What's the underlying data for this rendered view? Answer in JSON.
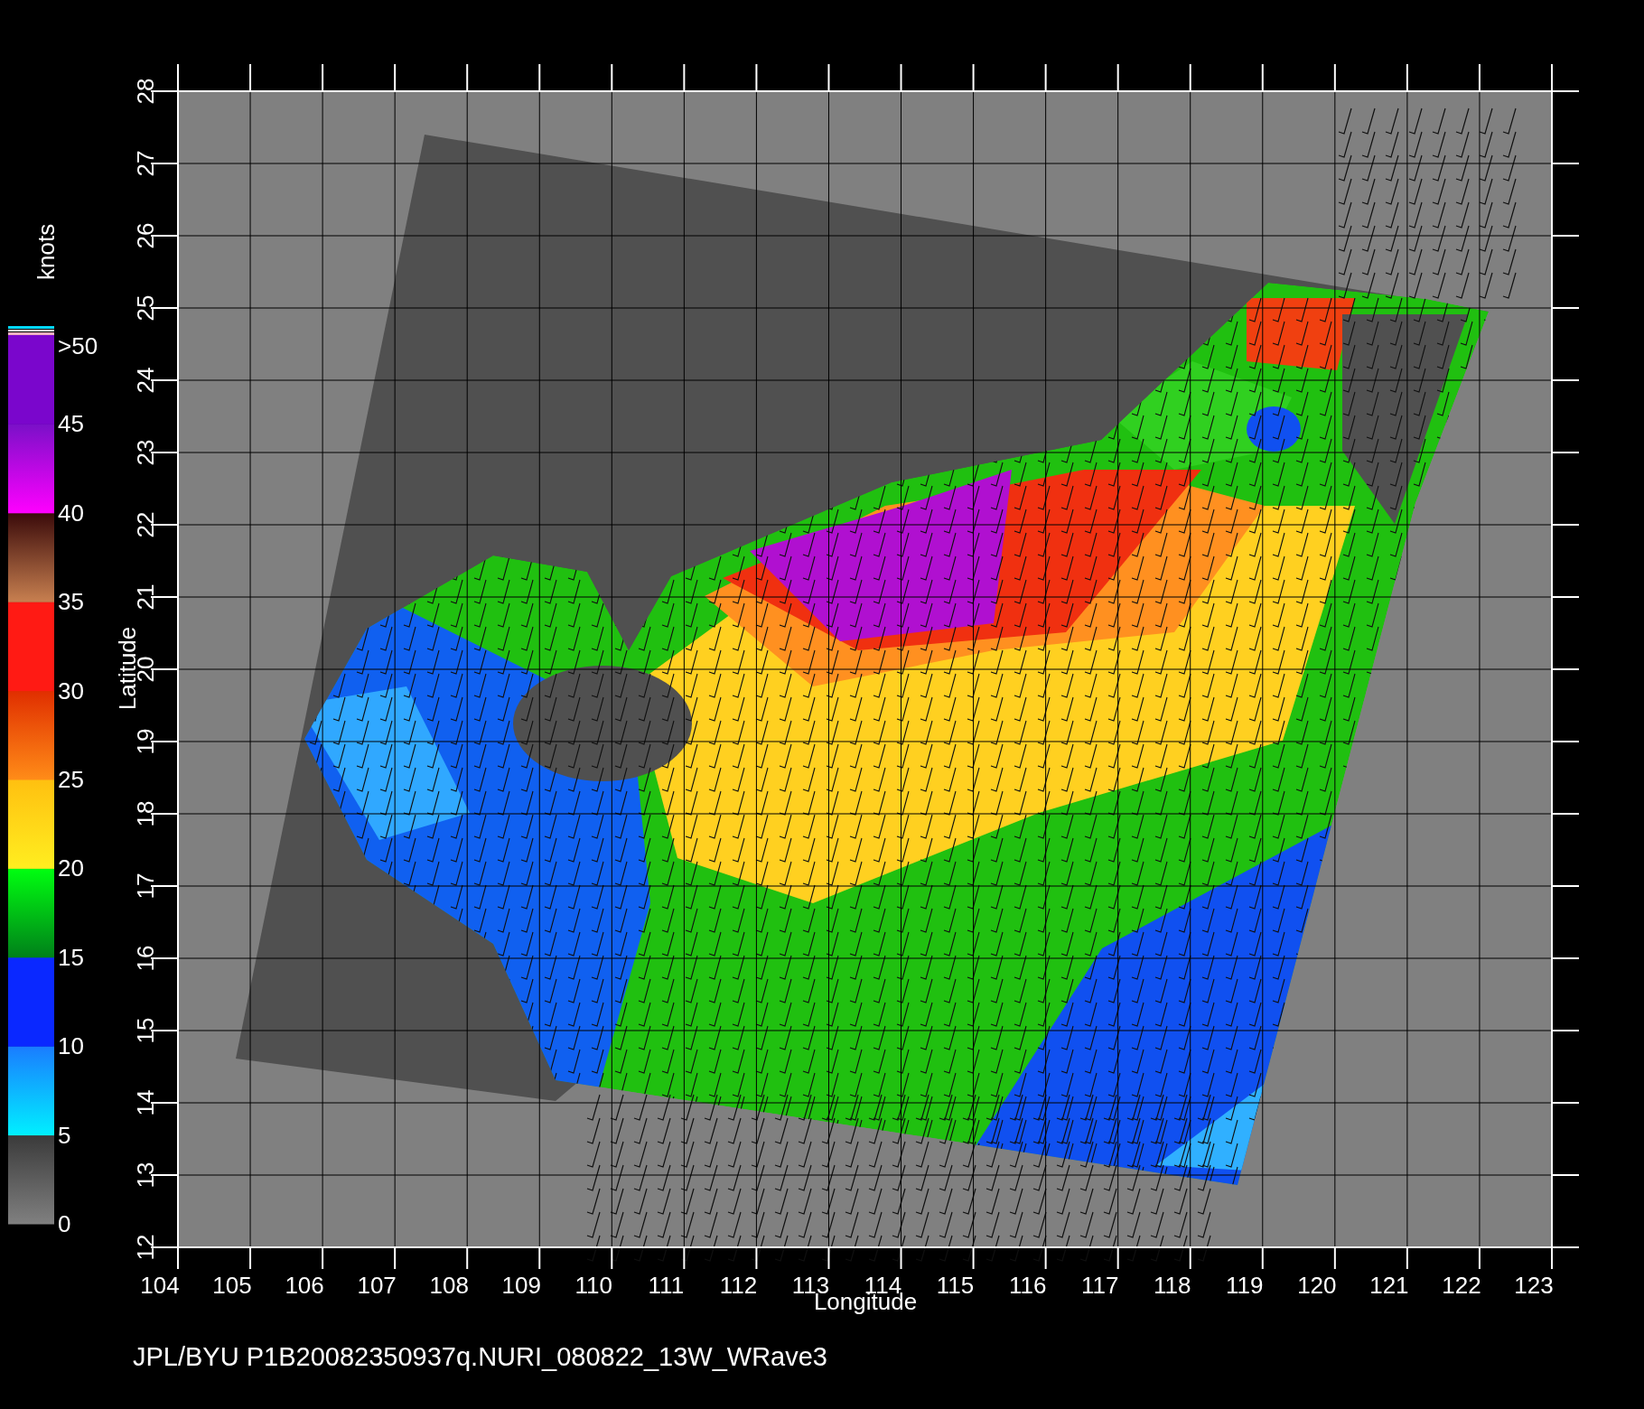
{
  "colorbar": {
    "title": "knots",
    "labels": [
      ">50",
      "45",
      "40",
      "35",
      "30",
      "25",
      "20",
      "15",
      "10",
      "5",
      "0"
    ]
  },
  "longitude_ticks": [
    "104",
    "105",
    "106",
    "107",
    "108",
    "109",
    "110",
    "111",
    "112",
    "113",
    "114",
    "115",
    "116",
    "117",
    "118",
    "119",
    "120",
    "121",
    "122",
    "123"
  ],
  "latitude_ticks": [
    "12",
    "13",
    "14",
    "15",
    "16",
    "17",
    "18",
    "19",
    "20",
    "21",
    "22",
    "23",
    "24",
    "25",
    "26",
    "27",
    "28"
  ],
  "x_axis_title": "Longitude",
  "y_axis_title": "Latitude",
  "caption": "JPL/BYU  P1B20082350937q.NURI_080822_13W_WRave3"
}
